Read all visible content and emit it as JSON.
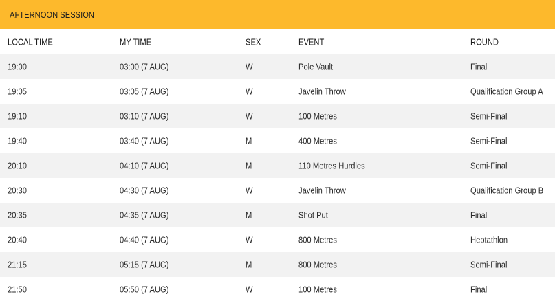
{
  "session": {
    "title": "AFTERNOON SESSION"
  },
  "columns": {
    "local_time": "LOCAL TIME",
    "my_time": "MY TIME",
    "sex": "SEX",
    "event": "EVENT",
    "round": "ROUND"
  },
  "rows": [
    {
      "local_time": "19:00",
      "my_time": "03:00 (7 AUG)",
      "sex": "W",
      "event": "Pole Vault",
      "round": "Final"
    },
    {
      "local_time": "19:05",
      "my_time": "03:05 (7 AUG)",
      "sex": "W",
      "event": "Javelin Throw",
      "round": "Qualification Group A"
    },
    {
      "local_time": "19:10",
      "my_time": "03:10 (7 AUG)",
      "sex": "W",
      "event": "100 Metres",
      "round": "Semi-Final"
    },
    {
      "local_time": "19:40",
      "my_time": "03:40 (7 AUG)",
      "sex": "M",
      "event": "400 Metres",
      "round": "Semi-Final"
    },
    {
      "local_time": "20:10",
      "my_time": "04:10 (7 AUG)",
      "sex": "M",
      "event": "110 Metres Hurdles",
      "round": "Semi-Final"
    },
    {
      "local_time": "20:30",
      "my_time": "04:30 (7 AUG)",
      "sex": "W",
      "event": "Javelin Throw",
      "round": "Qualification Group B"
    },
    {
      "local_time": "20:35",
      "my_time": "04:35 (7 AUG)",
      "sex": "M",
      "event": "Shot Put",
      "round": "Final"
    },
    {
      "local_time": "20:40",
      "my_time": "04:40 (7 AUG)",
      "sex": "W",
      "event": "800 Metres",
      "round": "Heptathlon"
    },
    {
      "local_time": "21:15",
      "my_time": "05:15 (7 AUG)",
      "sex": "M",
      "event": "800 Metres",
      "round": "Semi-Final"
    },
    {
      "local_time": "21:50",
      "my_time": "05:50 (7 AUG)",
      "sex": "W",
      "event": "100 Metres",
      "round": "Final"
    }
  ],
  "colors": {
    "header_bg": "#fdb92c",
    "stripe": "#f2f2f2",
    "text": "#2a2a2a"
  }
}
